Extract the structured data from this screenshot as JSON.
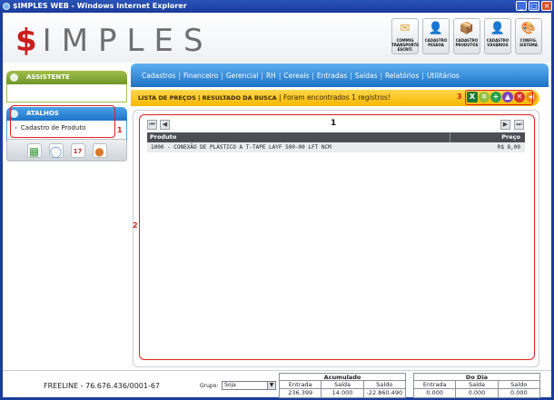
{
  "window": {
    "title": "$IMPLES WEB - Windows Internet Explorer"
  },
  "logo": {
    "dollar": "$",
    "rest": "IMPLES"
  },
  "topIcons": [
    {
      "icon": "coins-folder-icon",
      "label": "COMMIG TRANSPORTE ESCRIT.",
      "color": "#d9a02a",
      "glyph": "✉"
    },
    {
      "icon": "person-card-icon",
      "label": "CADASTRO PESSOA",
      "color": "#c44f2a",
      "glyph": "👤"
    },
    {
      "icon": "box-icon",
      "label": "CADASTRO PRODUTOS",
      "color": "#8a7a5a",
      "glyph": "📦"
    },
    {
      "icon": "user-icon",
      "label": "CADASTRO USUÁRIOS",
      "color": "#3d8f3d",
      "glyph": "👤"
    },
    {
      "icon": "color-palette-icon",
      "label": "CONFIG. SISTEMA",
      "color": "#c23bb5",
      "glyph": "🎨"
    }
  ],
  "sidebar": {
    "assist_title": "ASSISTENTE",
    "shortcuts_title": "ATALHOS",
    "shortcut_item": "Cadastro de Produto",
    "marker1": "1",
    "tools": [
      {
        "icon": "calculator-icon",
        "glyph": "▦",
        "color": "#3c9a3c"
      },
      {
        "icon": "chat-bubble-icon",
        "glyph": "◯",
        "color": "#5a8fd8"
      },
      {
        "icon": "calendar-icon",
        "glyph": "17",
        "color": "#b33"
      },
      {
        "icon": "user-avatar-icon",
        "glyph": "●",
        "color": "#d9792a"
      }
    ]
  },
  "nav": {
    "items": [
      "Cadastros",
      "Financeiro",
      "Gerencial",
      "RH",
      "Cereais",
      "Entradas",
      "Saídas",
      "Relatórios",
      "Utilitários"
    ]
  },
  "breadcrumb": {
    "section": "LISTA DE PREÇOS | RESULTADO DA BUSCA",
    "message": " | Foram encontrados 1 registros!"
  },
  "actions": {
    "marker3": "3",
    "buttons": [
      {
        "name": "excel-icon",
        "glyph": "X",
        "color": "#1d7a34"
      },
      {
        "name": "refresh-icon",
        "glyph": "✲",
        "color": "#8fbf3a"
      },
      {
        "name": "add-icon",
        "glyph": "+",
        "color": "#2aa04a"
      },
      {
        "name": "up-icon",
        "glyph": "▲",
        "color": "#7b3fbf"
      },
      {
        "name": "delete-icon",
        "glyph": "✕",
        "color": "#d9342a"
      },
      {
        "name": "back-icon",
        "glyph": "◀",
        "color": "#f08a1a"
      }
    ]
  },
  "grid": {
    "marker2": "2",
    "page": "1",
    "columns": [
      "Produto",
      "Preço"
    ],
    "rows": [
      {
        "produto": "1000 - CONEXÃO DE PLÁSTICO A T-TAPE LAYF 500-00 LFT NCM",
        "preco": "R$ 8,00"
      }
    ]
  },
  "footer": {
    "freeline": "FREELINE - 76.676.436/0001-67",
    "grupo_label": "Grupo:",
    "grupo_value": "Soja",
    "acumulado": {
      "title": "Acumulado",
      "headers": [
        "Entrada",
        "Saída",
        "Saldo"
      ],
      "values": [
        "236.399",
        "14.000",
        "-22.860.490"
      ]
    },
    "dodia": {
      "title": "Do Dia",
      "headers": [
        "Entrada",
        "Saída",
        "Saldo"
      ],
      "values": [
        "0.000",
        "0.000",
        "0.000"
      ]
    }
  }
}
